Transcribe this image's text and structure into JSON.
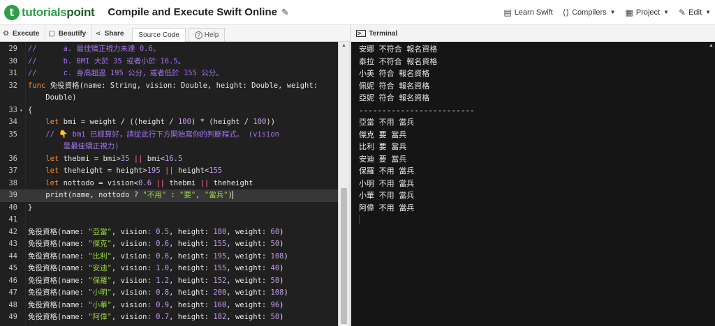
{
  "brand": {
    "logo_letter": "t",
    "name_main": "tutorials",
    "name_tail": "point"
  },
  "page_title": "Compile and Execute Swift Online",
  "topnav": [
    {
      "label": "Learn Swift",
      "icon": "book-icon",
      "caret": false
    },
    {
      "label": "Compilers",
      "icon": "code-icon",
      "caret": true
    },
    {
      "label": "Project",
      "icon": "grid-icon",
      "caret": true
    },
    {
      "label": "Edit",
      "icon": "edit-icon",
      "caret": true
    }
  ],
  "toolbar": {
    "execute": "Execute",
    "beautify": "Beautify",
    "share": "Share",
    "source_tab": "Source Code",
    "help": "Help"
  },
  "terminal": {
    "title": "Terminal"
  },
  "code_lines": [
    {
      "n": "29",
      "fold": false,
      "parts": [
        [
          "cm",
          "//      a. 最佳矯正視力未達 0.6。"
        ]
      ]
    },
    {
      "n": "30",
      "fold": false,
      "parts": [
        [
          "cm",
          "//      b. BMI 大於 35 或者小於 16.5。"
        ]
      ]
    },
    {
      "n": "31",
      "fold": false,
      "parts": [
        [
          "cm",
          "//      c. 身高超過 195 公分，或者低於 155 公分。"
        ]
      ]
    },
    {
      "n": "32",
      "fold": false,
      "parts": [
        [
          "kw",
          "func"
        ],
        [
          "tp",
          " 免役資格(name: String, vision: Double, height: Double, weight:"
        ]
      ]
    },
    {
      "n": "",
      "fold": false,
      "parts": [
        [
          "tp",
          "    Double)"
        ]
      ]
    },
    {
      "n": "33",
      "fold": true,
      "parts": [
        [
          "tp",
          "{"
        ]
      ]
    },
    {
      "n": "34",
      "fold": false,
      "parts": [
        [
          "tp",
          "    "
        ],
        [
          "kw",
          "let"
        ],
        [
          "tp",
          " bmi = weight / ((height / "
        ],
        [
          "nm",
          "100"
        ],
        [
          "tp",
          ") * (height / "
        ],
        [
          "nm",
          "100"
        ],
        [
          "tp",
          "))"
        ]
      ]
    },
    {
      "n": "35",
      "fold": false,
      "parts": [
        [
          "cm",
          "    // 👇 bmi 已經算好，請從此行下方開始寫你的判斷程式。 (vision"
        ]
      ]
    },
    {
      "n": "",
      "fold": false,
      "parts": [
        [
          "cm",
          "        是最佳矯正視力)"
        ]
      ]
    },
    {
      "n": "36",
      "fold": false,
      "parts": [
        [
          "tp",
          "    "
        ],
        [
          "kw",
          "let"
        ],
        [
          "tp",
          " thebmi = bmi>"
        ],
        [
          "nm",
          "35"
        ],
        [
          "tp",
          " "
        ],
        [
          "op",
          "||"
        ],
        [
          "tp",
          " bmi<"
        ],
        [
          "nm",
          "16.5"
        ]
      ]
    },
    {
      "n": "37",
      "fold": false,
      "parts": [
        [
          "tp",
          "    "
        ],
        [
          "kw",
          "let"
        ],
        [
          "tp",
          " theheight = height>"
        ],
        [
          "nm",
          "195"
        ],
        [
          "tp",
          " "
        ],
        [
          "op",
          "||"
        ],
        [
          "tp",
          " height<"
        ],
        [
          "nm",
          "155"
        ]
      ]
    },
    {
      "n": "38",
      "fold": false,
      "parts": [
        [
          "tp",
          "    "
        ],
        [
          "kw",
          "let"
        ],
        [
          "tp",
          " nottodo = vision<"
        ],
        [
          "nm",
          "0.6"
        ],
        [
          "tp",
          " "
        ],
        [
          "op",
          "||"
        ],
        [
          "tp",
          " thebmi "
        ],
        [
          "op",
          "||"
        ],
        [
          "tp",
          " theheight"
        ]
      ]
    },
    {
      "n": "39",
      "fold": false,
      "active": true,
      "parts": [
        [
          "tp",
          "    print(name, nottodo ? "
        ],
        [
          "st",
          "\"不用\""
        ],
        [
          "tp",
          " : "
        ],
        [
          "st",
          "\"要\""
        ],
        [
          "tp",
          ", "
        ],
        [
          "st",
          "\"當兵\""
        ],
        [
          "tp",
          ")"
        ]
      ]
    },
    {
      "n": "40",
      "fold": false,
      "parts": [
        [
          "tp",
          "}"
        ]
      ]
    },
    {
      "n": "41",
      "fold": false,
      "parts": [
        [
          "tp",
          ""
        ]
      ]
    },
    {
      "n": "42",
      "fold": false,
      "parts": [
        [
          "tp",
          "免役資格(name: "
        ],
        [
          "st",
          "\"亞當\""
        ],
        [
          "tp",
          ", vision: "
        ],
        [
          "nm",
          "0.5"
        ],
        [
          "tp",
          ", height: "
        ],
        [
          "nm",
          "180"
        ],
        [
          "tp",
          ", weight: "
        ],
        [
          "nm",
          "60"
        ],
        [
          "tp",
          ")"
        ]
      ]
    },
    {
      "n": "43",
      "fold": false,
      "parts": [
        [
          "tp",
          "免役資格(name: "
        ],
        [
          "st",
          "\"傑克\""
        ],
        [
          "tp",
          ", vision: "
        ],
        [
          "nm",
          "0.6"
        ],
        [
          "tp",
          ", height: "
        ],
        [
          "nm",
          "155"
        ],
        [
          "tp",
          ", weight: "
        ],
        [
          "nm",
          "50"
        ],
        [
          "tp",
          ")"
        ]
      ]
    },
    {
      "n": "44",
      "fold": false,
      "parts": [
        [
          "tp",
          "免役資格(name: "
        ],
        [
          "st",
          "\"比利\""
        ],
        [
          "tp",
          ", vision: "
        ],
        [
          "nm",
          "0.6"
        ],
        [
          "tp",
          ", height: "
        ],
        [
          "nm",
          "195"
        ],
        [
          "tp",
          ", weight: "
        ],
        [
          "nm",
          "108"
        ],
        [
          "tp",
          ")"
        ]
      ]
    },
    {
      "n": "45",
      "fold": false,
      "parts": [
        [
          "tp",
          "免役資格(name: "
        ],
        [
          "st",
          "\"安迪\""
        ],
        [
          "tp",
          ", vision: "
        ],
        [
          "nm",
          "1.0"
        ],
        [
          "tp",
          ", height: "
        ],
        [
          "nm",
          "155"
        ],
        [
          "tp",
          ", weight: "
        ],
        [
          "nm",
          "40"
        ],
        [
          "tp",
          ")"
        ]
      ]
    },
    {
      "n": "46",
      "fold": false,
      "parts": [
        [
          "tp",
          "免役資格(name: "
        ],
        [
          "st",
          "\"保羅\""
        ],
        [
          "tp",
          ", vision: "
        ],
        [
          "nm",
          "1.2"
        ],
        [
          "tp",
          ", height: "
        ],
        [
          "nm",
          "152"
        ],
        [
          "tp",
          ", weight: "
        ],
        [
          "nm",
          "50"
        ],
        [
          "tp",
          ")"
        ]
      ]
    },
    {
      "n": "47",
      "fold": false,
      "parts": [
        [
          "tp",
          "免役資格(name: "
        ],
        [
          "st",
          "\"小明\""
        ],
        [
          "tp",
          ", vision: "
        ],
        [
          "nm",
          "0.8"
        ],
        [
          "tp",
          ", height: "
        ],
        [
          "nm",
          "200"
        ],
        [
          "tp",
          ", weight: "
        ],
        [
          "nm",
          "108"
        ],
        [
          "tp",
          ")"
        ]
      ]
    },
    {
      "n": "48",
      "fold": false,
      "parts": [
        [
          "tp",
          "免役資格(name: "
        ],
        [
          "st",
          "\"小華\""
        ],
        [
          "tp",
          ", vision: "
        ],
        [
          "nm",
          "0.9"
        ],
        [
          "tp",
          ", height: "
        ],
        [
          "nm",
          "160"
        ],
        [
          "tp",
          ", weight: "
        ],
        [
          "nm",
          "96"
        ],
        [
          "tp",
          ")"
        ]
      ]
    },
    {
      "n": "49",
      "fold": false,
      "parts": [
        [
          "tp",
          "免役資格(name: "
        ],
        [
          "st",
          "\"阿偉\""
        ],
        [
          "tp",
          ", vision: "
        ],
        [
          "nm",
          "0.7"
        ],
        [
          "tp",
          ", height: "
        ],
        [
          "nm",
          "182"
        ],
        [
          "tp",
          ", weight: "
        ],
        [
          "nm",
          "50"
        ],
        [
          "tp",
          ")"
        ]
      ]
    }
  ],
  "terminal_lines": [
    "安娜 不符合 報名資格",
    "泰拉 不符合 報名資格",
    "小美 符合 報名資格",
    "佩妮 符合 報名資格",
    "亞妮 符合 報名資格",
    "-------------------------",
    "亞當 不用 當兵",
    "傑克 要 當兵",
    "比利 要 當兵",
    "安迪 要 當兵",
    "保羅 不用 當兵",
    "小明 不用 當兵",
    "小華 不用 當兵",
    "阿偉 不用 當兵"
  ]
}
